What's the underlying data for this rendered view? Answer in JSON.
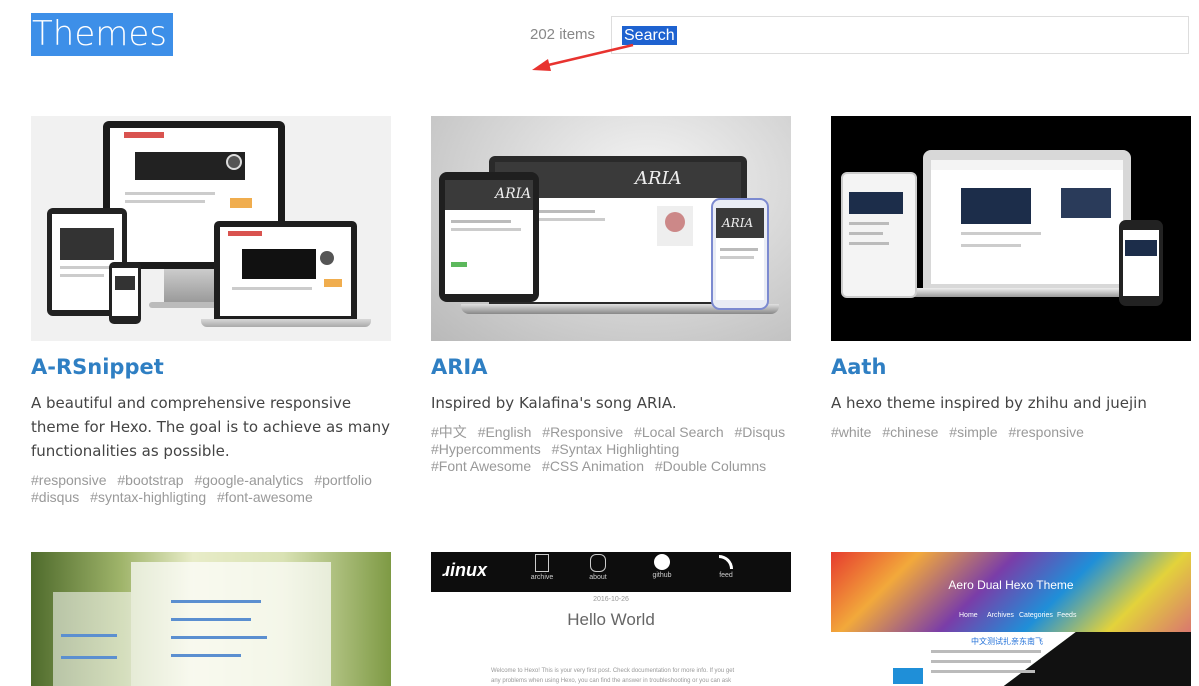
{
  "header": {
    "title": "Themes",
    "count": "202 items",
    "search_text": "Search"
  },
  "colors": {
    "title_bg": "#3d8fe8",
    "link": "#2f7fc3",
    "tag": "#999999",
    "arrow": "#e8332f"
  },
  "themes": [
    {
      "name": "A-RSnippet",
      "description": "A beautiful and comprehensive responsive theme for Hexo. The goal is to achieve as many functionalities as possible.",
      "tags": [
        "#responsive",
        "#bootstrap",
        "#google-analytics",
        "#portfolio",
        "#disqus",
        "#syntax-highligting",
        "#font-awesome"
      ]
    },
    {
      "name": "ARIA",
      "description": "Inspired by Kalafina's song ARIA.",
      "tags": [
        "#中文",
        "#English",
        "#Responsive",
        "#Local Search",
        "#Disqus",
        "#Hypercomments",
        "#Syntax Highlighting",
        "#Font Awesome",
        "#CSS Animation",
        "#Double Columns"
      ],
      "screenshot_text": "ARIA"
    },
    {
      "name": "Aath",
      "description": "A hexo theme inspired by zhihu and juejin",
      "tags": [
        "#white",
        "#chinese",
        "#simple",
        "#responsive"
      ]
    },
    {
      "name": "",
      "description": "",
      "tags": []
    },
    {
      "name": "",
      "description": "",
      "tags": [],
      "screenshot_logo": "ɹinux",
      "screenshot_nav": [
        "archive",
        "about",
        "github",
        "feed"
      ],
      "screenshot_date": "2016-10-26",
      "screenshot_heading": "Hello World",
      "screenshot_body": "Welcome to Hexo! This is your very first post. Check documentation for more info. If you get any problems when using Hexo, you can find the answer in troubleshooting or you can ask me on"
    },
    {
      "name": "",
      "description": "",
      "tags": [],
      "screenshot_heading": "Aero Dual Hexo Theme",
      "screenshot_nav": [
        "Home",
        "Archives",
        "Categories",
        "Feeds"
      ],
      "screenshot_subtitle": "中文测试扎亲东南飞"
    }
  ]
}
